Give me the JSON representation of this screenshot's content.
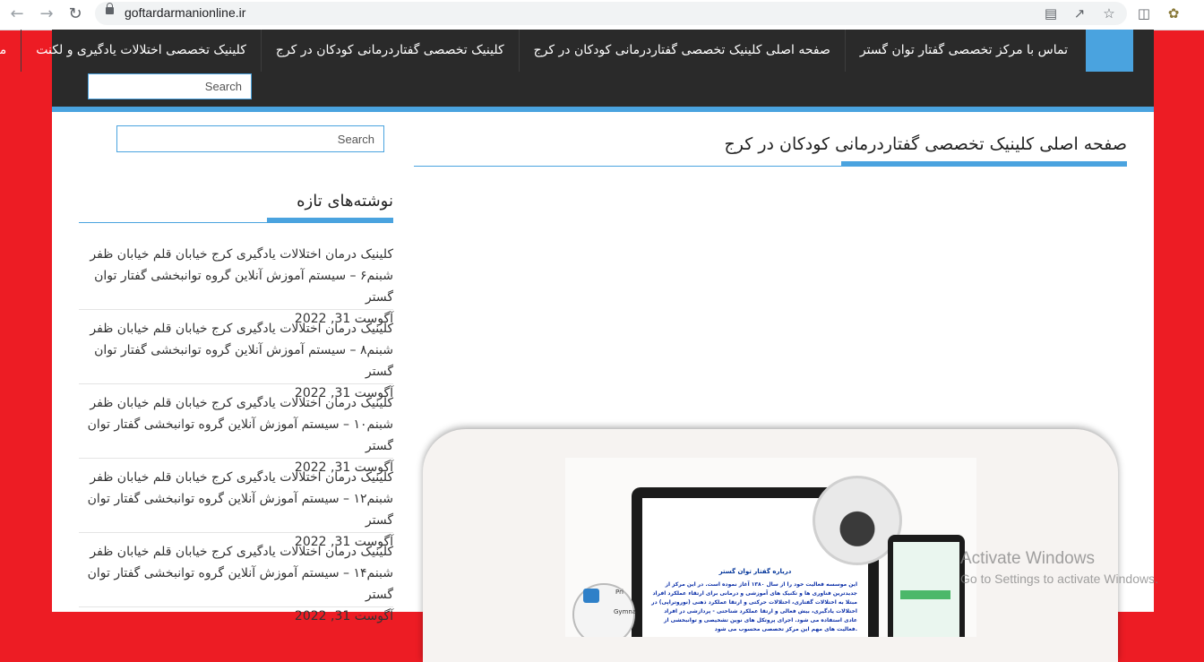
{
  "browser": {
    "url": "goftardarmanionline.ir",
    "icons": [
      "back-icon",
      "forward-icon",
      "reload-icon",
      "lock-icon",
      "translate-icon",
      "share-icon",
      "star-icon",
      "sidebar-icon",
      "extension-icon"
    ]
  },
  "nav": {
    "menu": [
      {
        "label": "تماس با مرکز تخصصی گفتار توان گستر"
      },
      {
        "label": "صفحه اصلی کلینیک تخصصی گفتاردرمانی کودکان در کرج"
      },
      {
        "label": "کلینیک تخصصی گفتاردرمانی کودکان در کرج"
      },
      {
        "label": "کلینیک تخصصی اختلالات یادگیری و لکنت"
      },
      {
        "label": "محصولات ما"
      }
    ],
    "search_placeholder": "Search"
  },
  "main": {
    "title": "صفحه اصلی کلینیک تخصصی گفتاردرمانی کودکان در کرج",
    "promo": {
      "heading": "درباره گفتار توان گستر",
      "text": "این موسسه فعالیت خود را از سال ۱۳۸۰ آغاز نموده است. در این مرکز از جدیدترین فناوری ها و تکنیک های آموزشی و درمانی برای ارتقاء عملکرد افراد مبتلا به اختلالات گفتاری، اختلالات حرکتی و ارتقا عملکرد ذهنی (نوروتراپی) در اختلالات یادگیری، بیش فعالی و ارتقا عملکرد شناختی - پردازشی در افراد عادی استفاده می شود. اجرای پروتکل های نوین تشخیصی و توانبخشی از فعالیت های مهم این مرکز تخصصی محسوب می شود.",
      "labels": [
        "Pri",
        "Gymna"
      ]
    }
  },
  "sidebar": {
    "search_placeholder": "Search",
    "widget_title": "نوشته‌های تازه",
    "posts": [
      {
        "title": "کلینیک درمان اختلالات یادگیری کرج خیابان قلم خیابان ظفر شبنم۶ – سیستم آموزش آنلاین گروه توانبخشی گفتار توان گستر",
        "date": "آگوست 31, 2022"
      },
      {
        "title": "کلینیک درمان اختلالات یادگیری کرج خیابان قلم خیابان ظفر شبنم۸ – سیستم آموزش آنلاین گروه توانبخشی گفتار توان گستر",
        "date": "آگوست 31, 2022"
      },
      {
        "title": "کلینیک درمان اختلالات یادگیری کرج خیابان قلم خیابان ظفر شبنم۱۰ – سیستم آموزش آنلاین گروه توانبخشی گفتار توان گستر",
        "date": "آگوست 31, 2022"
      },
      {
        "title": "کلینیک درمان اختلالات یادگیری کرج خیابان قلم خیابان ظفر شبنم۱۲ – سیستم آموزش آنلاین گروه توانبخشی گفتار توان گستر",
        "date": "آگوست 31, 2022"
      },
      {
        "title": "کلینیک درمان اختلالات یادگیری کرج خیابان قلم خیابان ظفر شبنم۱۴ – سیستم آموزش آنلاین گروه توانبخشی گفتار توان گستر",
        "date": "آگوست 31, 2022"
      }
    ]
  },
  "watermark": {
    "line1": "Activate Windows",
    "line2": "Go to Settings to activate Windows."
  },
  "colors": {
    "accent": "#4aa3df",
    "background": "#ed1c24",
    "navbar": "#2a2a2a"
  }
}
